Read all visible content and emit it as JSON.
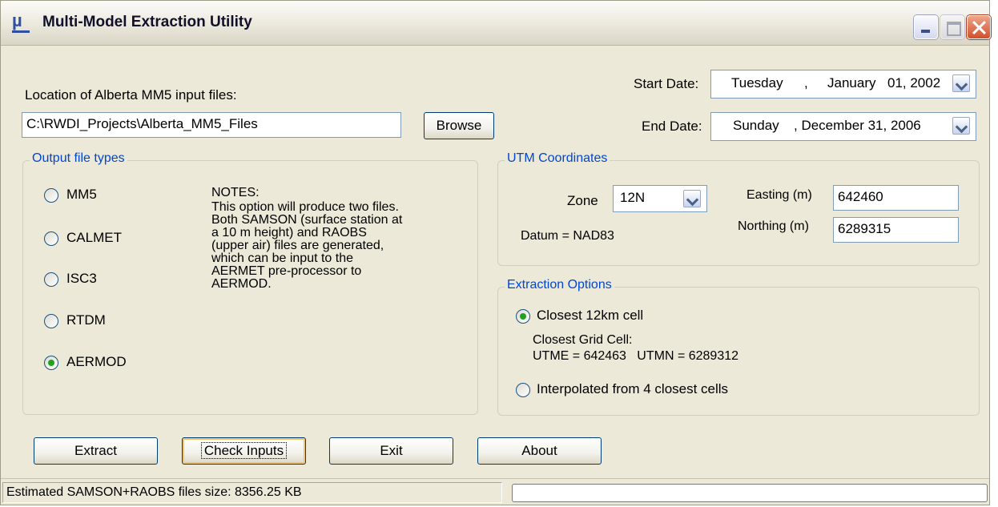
{
  "window": {
    "title": "Multi-Model Extraction Utility"
  },
  "input_location": {
    "label": "Location of Alberta MM5 input files:",
    "value": "C:\\RWDI_Projects\\Alberta_MM5_Files",
    "browse_label": "Browse"
  },
  "dates": {
    "start_label": "Start Date:",
    "start_weekday": "Tuesday",
    "start_sep": ",",
    "start_month": "January",
    "start_day_year": "01, 2002",
    "end_label": "End Date:",
    "end_weekday": "Sunday",
    "end_month": ", December 31, 2006"
  },
  "output_types": {
    "title": "Output file types",
    "options": [
      "MM5",
      "CALMET",
      "ISC3",
      "RTDM",
      "AERMOD"
    ],
    "selected": "AERMOD",
    "notes_heading": "NOTES:",
    "notes_text": "This option will produce two files.\nBoth SAMSON (surface station at\na 10 m height) and RAOBS\n(upper air) files are generated,\nwhich can be input to the\nAERMET pre-processor to\nAERMOD."
  },
  "utm": {
    "title": "UTM Coordinates",
    "zone_label": "Zone",
    "zone_value": "12N",
    "datum": "Datum = NAD83",
    "easting_label": "Easting (m)",
    "easting_value": "642460",
    "northing_label": "Northing (m)",
    "northing_value": "6289315"
  },
  "extraction": {
    "title": "Extraction Options",
    "option1": "Closest 12km cell",
    "grid_label": "Closest Grid Cell:",
    "grid_values": "UTME = 642463   UTMN = 6289312",
    "option2": "Interpolated from 4 closest cells",
    "selected": "Closest 12km cell"
  },
  "buttons": {
    "extract": "Extract",
    "check_inputs": "Check Inputs",
    "exit": "Exit",
    "about": "About"
  },
  "status": {
    "text": "Estimated SAMSON+RAOBS files size: 8356.25 KB"
  },
  "colors": {
    "group_title": "#0046d5",
    "window_bg": "#ece9d8",
    "radio_checked": "#21a121"
  }
}
